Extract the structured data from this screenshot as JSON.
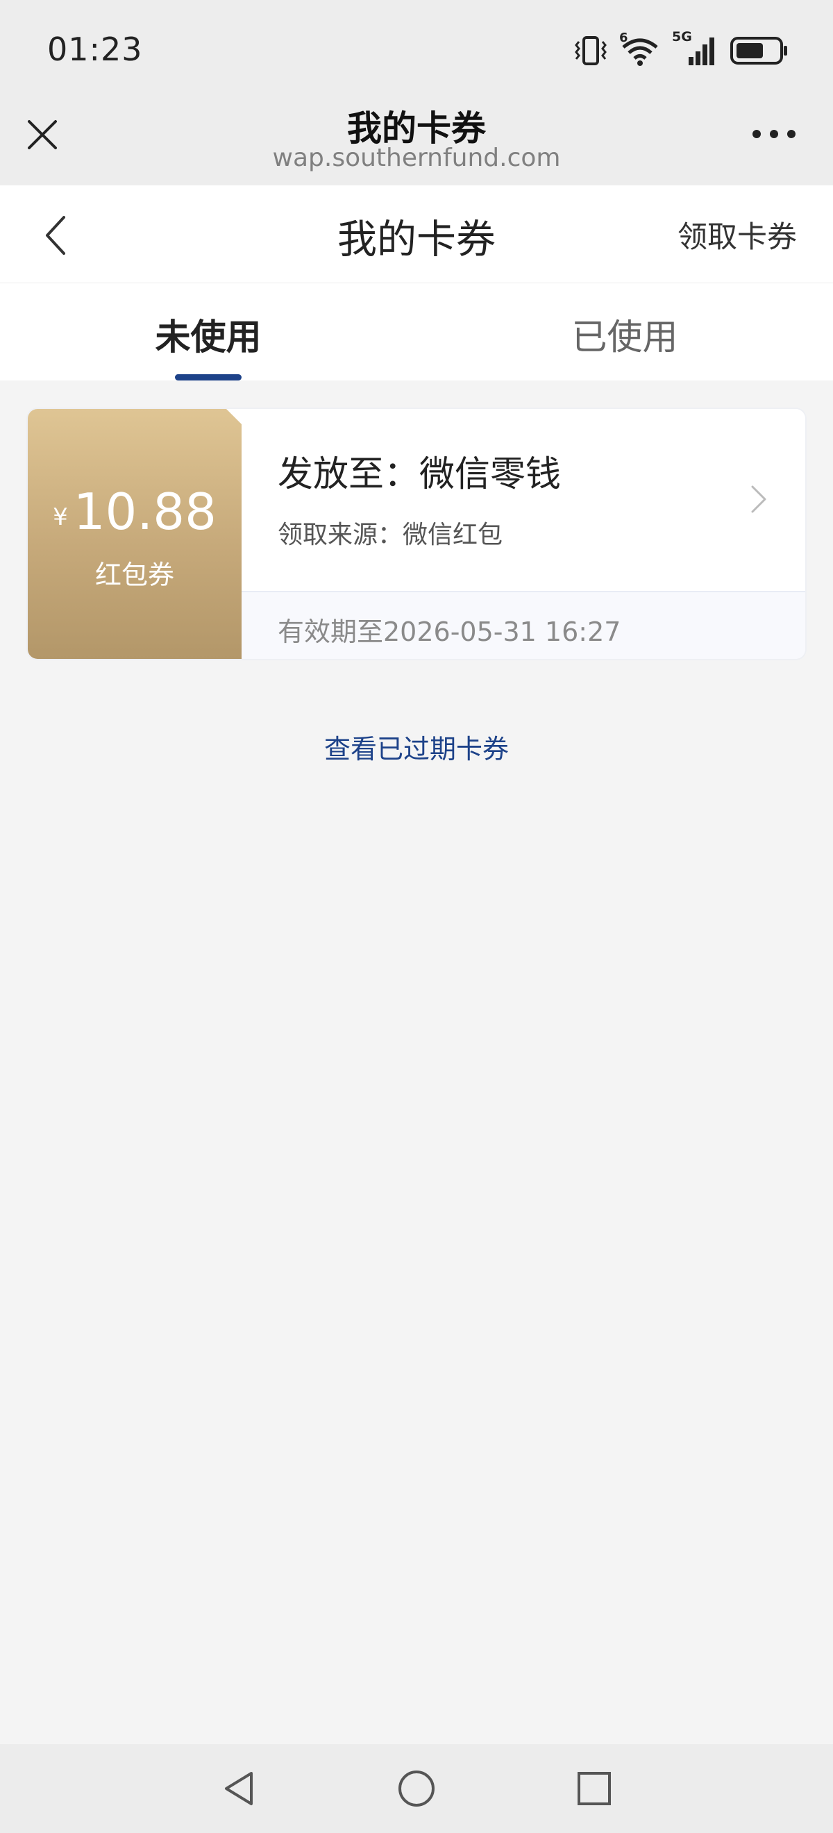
{
  "status_bar": {
    "time": "01:23",
    "network_label": "5G",
    "wifi_badge": "6",
    "icons": [
      "vibrate-icon",
      "wifi-icon",
      "signal-icon",
      "battery-icon"
    ]
  },
  "browser": {
    "title": "我的卡券",
    "url": "wap.southernfund.com",
    "icons": [
      "close-icon",
      "more-icon"
    ]
  },
  "header": {
    "title": "我的卡券",
    "receive_label": "领取卡券",
    "icons": [
      "back-icon"
    ]
  },
  "tabs": [
    {
      "label": "未使用",
      "active": true
    },
    {
      "label": "已使用",
      "active": false
    }
  ],
  "coupons": [
    {
      "currency": "¥",
      "amount": "10.88",
      "type": "红包券",
      "issue_to": "发放至：微信零钱",
      "source": "领取来源：微信红包",
      "validity": "有效期至2026-05-31 16:27"
    }
  ],
  "expired_link": "查看已过期卡券",
  "colors": {
    "accent": "#1d4289",
    "coupon_gold_top": "#dfc594",
    "coupon_gold_bottom": "#b39769",
    "background": "#f4f4f4"
  },
  "nav": {
    "icons": [
      "nav-back-icon",
      "nav-home-icon",
      "nav-recents-icon"
    ]
  }
}
